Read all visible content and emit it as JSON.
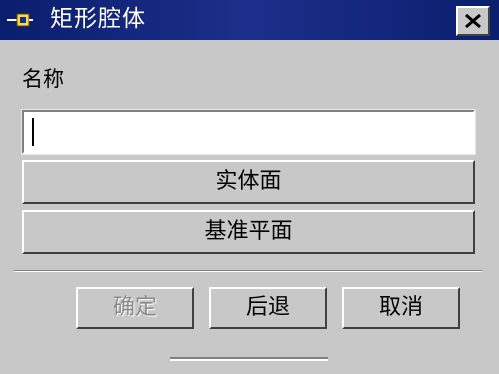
{
  "window": {
    "title": "矩形腔体",
    "icon": "cavity-app-icon",
    "close_icon": "close-icon"
  },
  "form": {
    "name_label": "名称",
    "name_value": "",
    "name_placeholder": ""
  },
  "buttons": {
    "solid_face": "实体面",
    "datum_plane": "基准平面",
    "ok": "确定",
    "back": "后退",
    "cancel": "取消"
  },
  "state": {
    "ok_enabled": false
  }
}
